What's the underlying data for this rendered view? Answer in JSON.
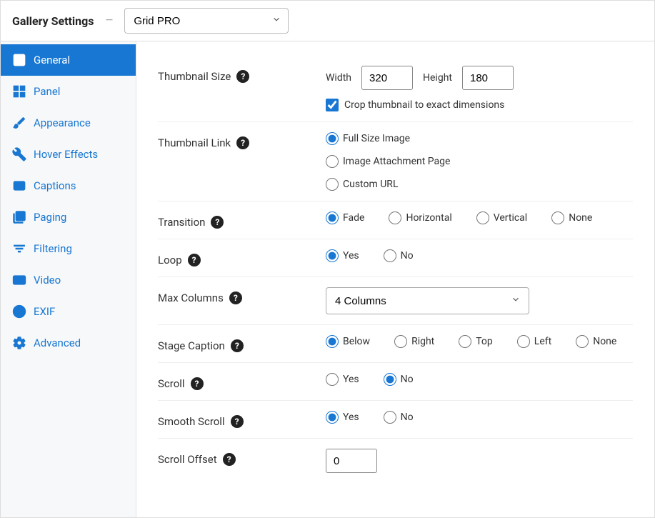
{
  "header": {
    "title": "Gallery Settings",
    "template_selected": "Grid PRO"
  },
  "sidebar": {
    "items": [
      {
        "label": "General"
      },
      {
        "label": "Panel"
      },
      {
        "label": "Appearance"
      },
      {
        "label": "Hover Effects"
      },
      {
        "label": "Captions"
      },
      {
        "label": "Paging"
      },
      {
        "label": "Filtering"
      },
      {
        "label": "Video"
      },
      {
        "label": "EXIF"
      },
      {
        "label": "Advanced"
      }
    ]
  },
  "settings": {
    "thumbnail_size": {
      "label": "Thumbnail Size",
      "width_label": "Width",
      "width_value": "320",
      "height_label": "Height",
      "height_value": "180",
      "crop_label": "Crop thumbnail to exact dimensions",
      "crop_checked": true
    },
    "thumbnail_link": {
      "label": "Thumbnail Link",
      "options": [
        {
          "label": "Full Size Image"
        },
        {
          "label": "Image Attachment Page"
        },
        {
          "label": "Custom URL"
        }
      ],
      "selected": "Full Size Image"
    },
    "transition": {
      "label": "Transition",
      "options": [
        {
          "label": "Fade"
        },
        {
          "label": "Horizontal"
        },
        {
          "label": "Vertical"
        },
        {
          "label": "None"
        }
      ],
      "selected": "Fade"
    },
    "loop": {
      "label": "Loop",
      "options": [
        {
          "label": "Yes"
        },
        {
          "label": "No"
        }
      ],
      "selected": "Yes"
    },
    "max_columns": {
      "label": "Max Columns",
      "selected": "4 Columns"
    },
    "stage_caption": {
      "label": "Stage Caption",
      "options": [
        {
          "label": "Below"
        },
        {
          "label": "Right"
        },
        {
          "label": "Top"
        },
        {
          "label": "Left"
        },
        {
          "label": "None"
        }
      ],
      "selected": "Below"
    },
    "scroll": {
      "label": "Scroll",
      "options": [
        {
          "label": "Yes"
        },
        {
          "label": "No"
        }
      ],
      "selected": "No"
    },
    "smooth_scroll": {
      "label": "Smooth Scroll",
      "options": [
        {
          "label": "Yes"
        },
        {
          "label": "No"
        }
      ],
      "selected": "Yes"
    },
    "scroll_offset": {
      "label": "Scroll Offset",
      "value": "0"
    }
  }
}
